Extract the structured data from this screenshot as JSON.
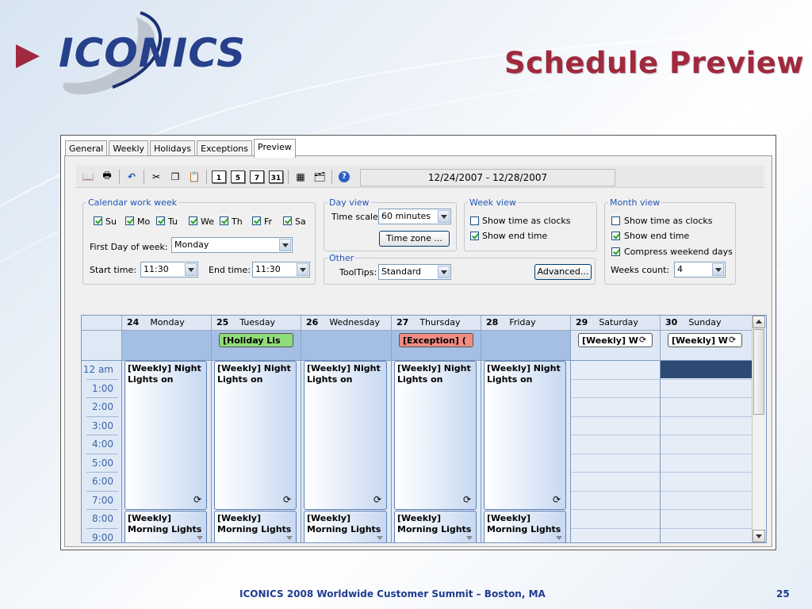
{
  "slide": {
    "title": "Schedule Preview",
    "logo_text": "ICONICS",
    "footer_text": "ICONICS 2008 Worldwide Customer Summit – Boston, MA",
    "page_number": "25"
  },
  "tabs": [
    "General",
    "Weekly",
    "Holidays",
    "Exceptions",
    "Preview"
  ],
  "active_tab": "Preview",
  "toolbar": {
    "icons": [
      "book-icon",
      "print-icon",
      "undo-icon",
      "cut-icon",
      "copy-icon",
      "paste-icon",
      "day-view-icon",
      "workweek-view-icon",
      "week-view-icon",
      "month-view-icon",
      "calendar-icon",
      "properties-icon",
      "help-icon"
    ],
    "cal_labels": [
      "1",
      "5",
      "7",
      "31"
    ],
    "date_range": "12/24/2007 - 12/28/2007"
  },
  "calendar_work_week": {
    "legend": "Calendar work week",
    "days": [
      {
        "label": "Su",
        "checked": true
      },
      {
        "label": "Mo",
        "checked": true
      },
      {
        "label": "Tu",
        "checked": true
      },
      {
        "label": "We",
        "checked": true
      },
      {
        "label": "Th",
        "checked": true
      },
      {
        "label": "Fr",
        "checked": true
      },
      {
        "label": "Sa",
        "checked": true
      }
    ],
    "first_day_label": "First Day of week:",
    "first_day_value": "Monday",
    "start_time_label": "Start time:",
    "start_time_value": "11:30",
    "end_time_label": "End time:",
    "end_time_value": "11:30"
  },
  "day_view": {
    "legend": "Day view",
    "time_scale_label": "Time scale:",
    "time_scale_value": "60 minutes",
    "time_zone_button": "Time zone ..."
  },
  "week_view": {
    "legend": "Week view",
    "show_time_as_clocks": {
      "label": "Show time as clocks",
      "checked": false
    },
    "show_end_time": {
      "label": "Show end time",
      "checked": true
    }
  },
  "month_view": {
    "legend": "Month view",
    "show_time_as_clocks": {
      "label": "Show time as clocks",
      "checked": false
    },
    "show_end_time": {
      "label": "Show end time",
      "checked": true
    },
    "compress_weekend": {
      "label": "Compress weekend days",
      "checked": true
    },
    "weeks_count_label": "Weeks count:",
    "weeks_count_value": "4"
  },
  "other": {
    "legend": "Other",
    "tooltips_label": "ToolTips:",
    "tooltips_value": "Standard",
    "advanced_button": "Advanced..."
  },
  "schedule": {
    "days": [
      {
        "num": "24",
        "name": "Monday",
        "tag": "",
        "weekend": false
      },
      {
        "num": "25",
        "name": "Tuesday",
        "tag": "[Holiday Lis",
        "tag_color": "#8fdc7a",
        "weekend": false
      },
      {
        "num": "26",
        "name": "Wednesday",
        "tag": "",
        "weekend": false
      },
      {
        "num": "27",
        "name": "Thursday",
        "tag": "[Exception] (",
        "tag_color": "#f08c84",
        "weekend": false
      },
      {
        "num": "28",
        "name": "Friday",
        "tag": "",
        "weekend": false
      },
      {
        "num": "29",
        "name": "Saturday",
        "tag": "[Weekly] W",
        "tag_color": "#ffffff",
        "weekend": true
      },
      {
        "num": "30",
        "name": "Sunday",
        "tag": "[Weekly] W",
        "tag_color": "#ffffff",
        "weekend": true
      }
    ],
    "times": [
      "12 am",
      "1:00",
      "2:00",
      "3:00",
      "4:00",
      "5:00",
      "6:00",
      "7:00",
      "8:00",
      "9:00"
    ],
    "night_event": "[Weekly] Night Lights on",
    "morning_event": "[Weekly] Morning Lights"
  },
  "colors": {
    "title": "#a0293e",
    "accent": "#1f55b8",
    "allday_bg": "#a4bfe3",
    "grid_bg": "#dfe9f6",
    "selected_cell": "#2e4a72"
  }
}
